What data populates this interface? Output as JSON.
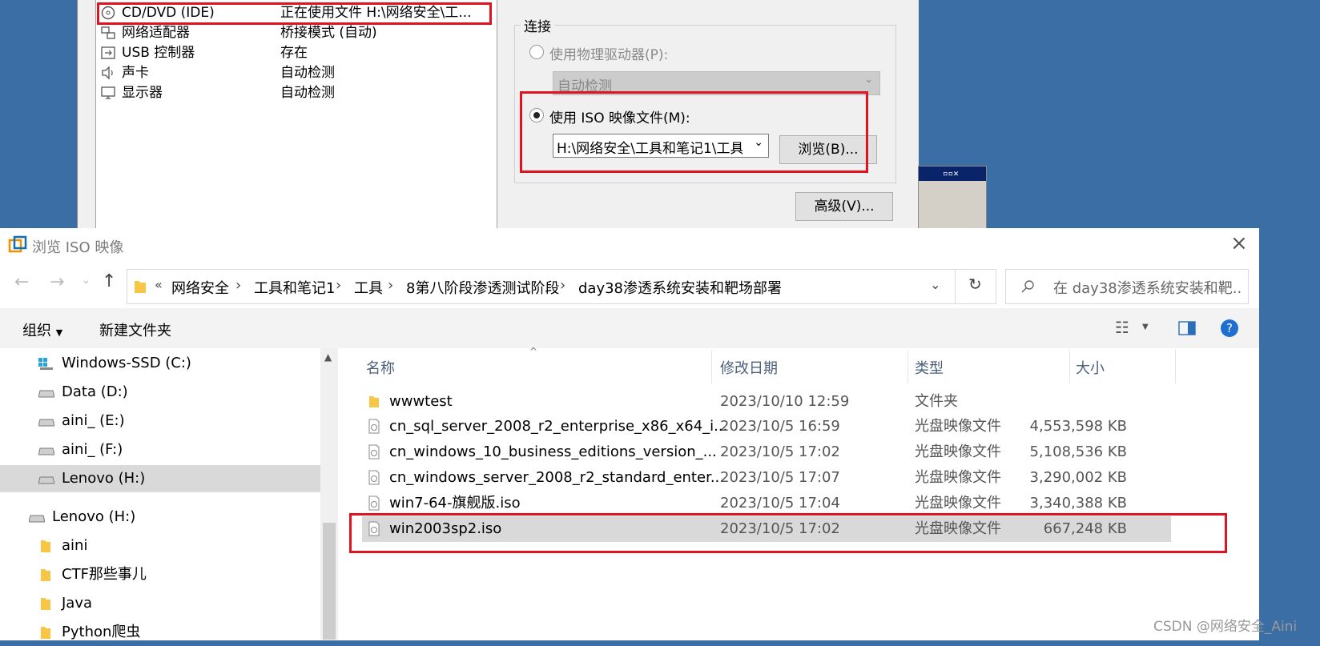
{
  "vm_dialog": {
    "hardware": [
      {
        "icon": "disc-icon",
        "name": "CD/DVD (IDE)",
        "summary": "正在使用文件 H:\\网络安全\\工..."
      },
      {
        "icon": "network-adapter-icon",
        "name": "网络适配器",
        "summary": "桥接模式 (自动)"
      },
      {
        "icon": "usb-icon",
        "name": "USB 控制器",
        "summary": "存在"
      },
      {
        "icon": "speaker-icon",
        "name": "声卡",
        "summary": "自动检测"
      },
      {
        "icon": "monitor-icon",
        "name": "显示器",
        "summary": "自动检测"
      }
    ],
    "connection": {
      "title": "连接",
      "physical_label": "使用物理驱动器(P):",
      "physical_value": "自动检测",
      "iso_label": "使用 ISO 映像文件(M):",
      "iso_path": "H:\\网络安全\\工具和笔记1\\工具",
      "browse_button": "浏览(B)...",
      "advanced_button": "高级(V)..."
    }
  },
  "file_dialog": {
    "title": "浏览 ISO 映像",
    "breadcrumb": [
      "网络安全",
      "工具和笔记1",
      "工具",
      "8第八阶段渗透测试阶段",
      "day38渗透系统安装和靶场部署"
    ],
    "search_placeholder": "在 day38渗透系统安装和靶...",
    "toolbar": {
      "organize": "组织",
      "new_folder": "新建文件夹"
    },
    "nav": [
      {
        "label": "Windows-SSD (C:)",
        "icon": "drive-windows-icon"
      },
      {
        "label": "Data (D:)",
        "icon": "drive-icon"
      },
      {
        "label": "aini_ (E:)",
        "icon": "drive-icon"
      },
      {
        "label": "aini_ (F:)",
        "icon": "drive-icon"
      },
      {
        "label": "Lenovo (H:)",
        "icon": "drive-icon",
        "selected": true
      },
      {
        "label": "Lenovo (H:)",
        "icon": "drive-icon"
      },
      {
        "label": "aini",
        "icon": "folder-icon"
      },
      {
        "label": "CTF那些事儿",
        "icon": "folder-icon"
      },
      {
        "label": "Java",
        "icon": "folder-icon"
      },
      {
        "label": "Python爬虫",
        "icon": "folder-icon"
      }
    ],
    "columns": {
      "name": "名称",
      "date": "修改日期",
      "type": "类型",
      "size": "大小"
    },
    "files": [
      {
        "name": "wwwtest",
        "date": "2023/10/10 12:59",
        "type": "文件夹",
        "size": "",
        "icon": "folder-icon"
      },
      {
        "name": "cn_sql_server_2008_r2_enterprise_x86_x64_i...",
        "date": "2023/10/5 16:59",
        "type": "光盘映像文件",
        "size": "4,553,598 KB",
        "icon": "disc-image-icon"
      },
      {
        "name": "cn_windows_10_business_editions_version_...",
        "date": "2023/10/5 17:02",
        "type": "光盘映像文件",
        "size": "5,108,536 KB",
        "icon": "disc-image-icon"
      },
      {
        "name": "cn_windows_server_2008_r2_standard_enter...",
        "date": "2023/10/5 17:07",
        "type": "光盘映像文件",
        "size": "3,290,002 KB",
        "icon": "disc-image-icon"
      },
      {
        "name": "win7-64-旗舰版.iso",
        "date": "2023/10/5 17:04",
        "type": "光盘映像文件",
        "size": "3,340,388 KB",
        "icon": "disc-image-icon"
      },
      {
        "name": "win2003sp2.iso",
        "date": "2023/10/5 17:02",
        "type": "光盘映像文件",
        "size": "667,248 KB",
        "icon": "disc-image-icon",
        "selected": true
      }
    ]
  },
  "watermark": "CSDN @网络安全_Aini",
  "colors": {
    "highlight": "#e0141e",
    "desktop": "#3a6ea5",
    "selection": "#d9d9d9"
  }
}
